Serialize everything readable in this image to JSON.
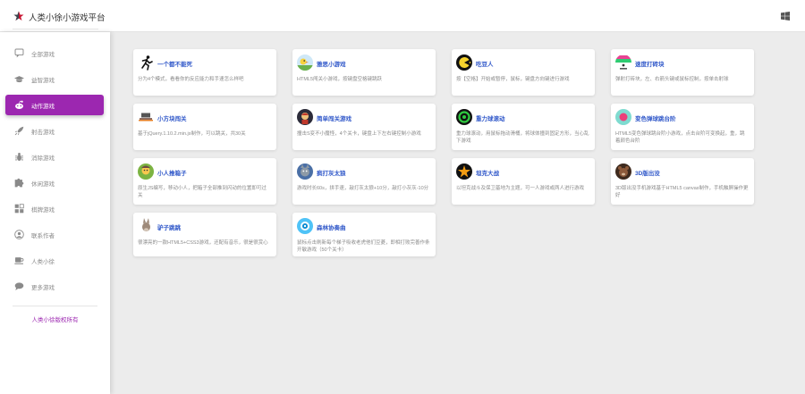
{
  "header": {
    "brand": "人类小徐小游戏平台"
  },
  "sidebar": {
    "items": [
      {
        "label": "全部游戏",
        "icon": "chat-bubble-icon",
        "active": false
      },
      {
        "label": "益智游戏",
        "icon": "graduation-cap-icon",
        "active": false
      },
      {
        "label": "动作游戏",
        "icon": "reddit-alien-icon",
        "active": true
      },
      {
        "label": "射击游戏",
        "icon": "rocket-icon",
        "active": false
      },
      {
        "label": "消除游戏",
        "icon": "bug-icon",
        "active": false
      },
      {
        "label": "休闲游戏",
        "icon": "puzzle-icon",
        "active": false
      },
      {
        "label": "棋牌游戏",
        "icon": "blocks-icon",
        "active": false
      },
      {
        "label": "联系作者",
        "icon": "user-icon",
        "active": false
      },
      {
        "label": "人类小徐",
        "icon": "coffee-cup-icon",
        "active": false
      },
      {
        "label": "更多游戏",
        "icon": "comments-icon",
        "active": false
      }
    ],
    "copyright": "人类小徐版权所有"
  },
  "games": [
    {
      "title": "一个都不能死",
      "desc": "分为4个模式，看看你的反应能力和手速怎么样吧",
      "icon": "running-man-icon"
    },
    {
      "title": "雅思小游戏",
      "desc": "HTML5闯关小游戏，按键盘空格键跳跃",
      "icon": "jumping-bird-icon"
    },
    {
      "title": "吃豆人",
      "desc": "按【空格】开始或暂停，鼠标，键盘方向键进行游戏",
      "icon": "pacman-icon"
    },
    {
      "title": "速度打砖块",
      "desc": "弹射打砖块，左、右箭头键或鼠标控制，按单击射球",
      "icon": "brick-ball-icon"
    },
    {
      "title": "小方块闯关",
      "desc": "基于jQuery.1.10.2.min.js制作，可以跳关，共30关",
      "icon": "block-jumper-icon"
    },
    {
      "title": "简单闯关游戏",
      "desc": "撞击S变不小魔怪，4个关卡，键盘上下左右键控制小游戏",
      "icon": "hero-icon"
    },
    {
      "title": "重力球滚动",
      "desc": "重力球滚动，用鼠标拖动滑桶，将球体撞到固定方形，当心乱下游戏",
      "icon": "gravity-ball-icon"
    },
    {
      "title": "变色弹球跳台阶",
      "desc": "HTML5变色弹球跳台阶小游戏，点击台阶可变换起，重，跳着颜色台阶",
      "icon": "color-ball-icon"
    },
    {
      "title": "小人推箱子",
      "desc": "原生JS编写，移动小人，把箱子全部推到闪动的位置即可过关",
      "icon": "box-pusher-icon"
    },
    {
      "title": "疯打灰太狼",
      "desc": "游戏时长60s，拼手速，敲打灰太狼+10分，敲打小灰灰-10分",
      "icon": "wolf-icon"
    },
    {
      "title": "坦克大战",
      "desc": "以坦克战斗及保卫基地为主题，可一人游戏或两人进行游戏",
      "icon": "tank-icon"
    },
    {
      "title": "3D版出没",
      "desc": "3D版出没手机游戏基于HTML5 canvas制作，手机触屏操作更好",
      "icon": "bear-icon"
    },
    {
      "title": "驴子跳跳",
      "desc": "很漂亮的一款HTML5+CSS3游戏，还配有音乐，很是很赏心",
      "icon": "donkey-icon"
    },
    {
      "title": "森林协奏曲",
      "desc": "鼠标点击刷新每个梯子吸收老虎他们豆菱，即相打败完善作条开敏游戏（50个关卡）",
      "icon": "forest-icon"
    }
  ]
}
